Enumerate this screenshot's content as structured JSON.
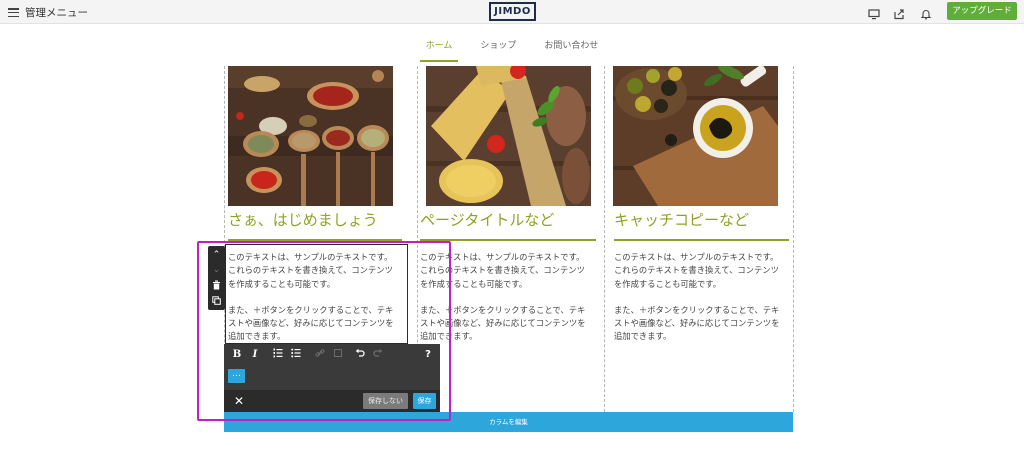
{
  "topbar": {
    "menu_label": "管理メニュー",
    "logo": "JIMDO",
    "upgrade_label": "アップグレード",
    "icons": [
      "desktop-preview-icon",
      "share-icon",
      "notification-bell-icon"
    ]
  },
  "nav": {
    "items": [
      {
        "label": "ホーム",
        "active": true
      },
      {
        "label": "ショップ",
        "active": false
      },
      {
        "label": "お問い合わせ",
        "active": false
      }
    ]
  },
  "columns": [
    {
      "image": "spices-photo",
      "title": "さぁ、はじめましょう",
      "p1": [
        "このテキストは、サンプルのテキストです。",
        "これらのテキストを書き換えて、コンテンツ",
        "を作成することも可能です。"
      ],
      "p2": [
        "また、＋ボタンをクリックすることで、テキ",
        "ストや画像など、好みに応じてコンテンツを",
        "追加できます。"
      ]
    },
    {
      "image": "pasta-photo",
      "title": "ページタイトルなど",
      "p1": [
        "このテキストは、サンプルのテキストです。",
        "これらのテキストを書き換えて、コンテンツ",
        "を作成することも可能です。"
      ],
      "p2": [
        "また、＋ボタンをクリックすることで、テキ",
        "ストや画像など、好みに応じてコンテンツを",
        "追加できます。"
      ]
    },
    {
      "image": "olives-photo",
      "title": "キャッチコピーなど",
      "p1": [
        "このテキストは、サンプルのテキストです。",
        "これらのテキストを書き換えて、コンテンツ",
        "を作成することも可能です。"
      ],
      "p2": [
        "また、＋ボタンをクリックすることで、テキ",
        "ストや画像など、好みに応じてコンテンツを",
        "追加できます。"
      ]
    }
  ],
  "side_toolbar": {
    "up": "⌃",
    "down": "⌄",
    "delete": "🗑",
    "copy": "⧉"
  },
  "editor": {
    "bold": "B",
    "italic": "I",
    "ordered_list": "≡",
    "bullet_list": "≣",
    "link": "🔗",
    "unlink": "⛓",
    "undo": "↶",
    "redo": "↷",
    "help": "?",
    "more": "…",
    "close": "✕",
    "cancel_label": "保存しない",
    "save_label": "保存"
  },
  "column_bar_label": "カラムを編集",
  "colors": {
    "accent_green": "#8ea325",
    "upgrade_green": "#5fae3a",
    "editor_blue": "#2da6dc",
    "highlight_magenta": "#c21fc1",
    "logo_navy": "#1e2d4a"
  }
}
